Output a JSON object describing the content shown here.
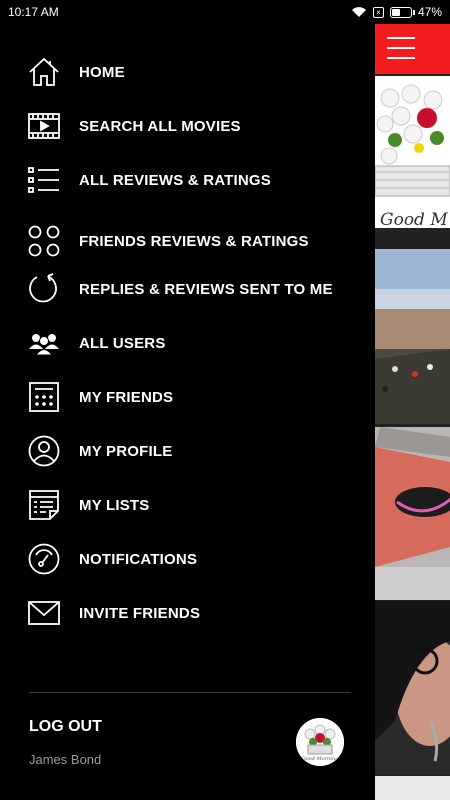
{
  "status_bar": {
    "time": "10:17 AM",
    "battery": "47%",
    "battery_level": 0.47
  },
  "menu": {
    "items": [
      {
        "label": "HOME",
        "icon": "home-icon"
      },
      {
        "label": "SEARCH ALL MOVIES",
        "icon": "film-icon"
      },
      {
        "label": "ALL REVIEWS & RATINGS",
        "icon": "list-icon"
      },
      {
        "label": "FRIENDS REVIEWS & RATINGS",
        "icon": "four-circles-icon"
      },
      {
        "label": "REPLIES & REVIEWS SENT TO ME",
        "icon": "refresh-icon"
      },
      {
        "label": "ALL USERS",
        "icon": "users-icon"
      },
      {
        "label": "MY FRIENDS",
        "icon": "calculator-icon"
      },
      {
        "label": "MY PROFILE",
        "icon": "user-circle-icon"
      },
      {
        "label": "MY LISTS",
        "icon": "notes-icon"
      },
      {
        "label": "NOTIFICATIONS",
        "icon": "gauge-icon"
      },
      {
        "label": "INVITE FRIENDS",
        "icon": "envelope-icon"
      }
    ]
  },
  "footer": {
    "logout_label": "LOG OUT",
    "username": "James Bond"
  },
  "content": {
    "tile_caption": "Good M"
  },
  "colors": {
    "accent": "#f21c1c",
    "background": "#000000"
  }
}
